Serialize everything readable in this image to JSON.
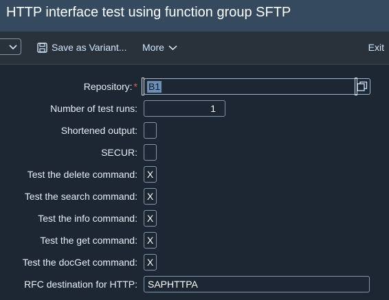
{
  "title": "HTTP interface test using function group SFTP",
  "toolbar": {
    "save_variant_label": "Save as Variant...",
    "more_label": "More",
    "exit_label": "Exit"
  },
  "form": {
    "repository": {
      "label": "Repository:",
      "required_mark": "*",
      "value": "B1"
    },
    "test_runs": {
      "label": "Number of test runs:",
      "value": "1"
    },
    "shortened_output": {
      "label": "Shortened output:",
      "value": ""
    },
    "secur": {
      "label": "SECUR:",
      "value": ""
    },
    "delete_cmd": {
      "label": "Test the delete command:",
      "value": "X"
    },
    "search_cmd": {
      "label": "Test the search command:",
      "value": "X"
    },
    "info_cmd": {
      "label": "Test the info command:",
      "value": "X"
    },
    "get_cmd": {
      "label": "Test the get command:",
      "value": "X"
    },
    "docget_cmd": {
      "label": "Test the docGet command:",
      "value": "X"
    },
    "rfc_dest": {
      "label": "RFC destination for HTTP:",
      "value": "SAPHTTPA"
    }
  },
  "colors": {
    "title_bar": "#354a5f",
    "toolbar": "#29313a",
    "background": "#1c2733",
    "link": "#d1e8ff",
    "required": "#ff5858"
  }
}
